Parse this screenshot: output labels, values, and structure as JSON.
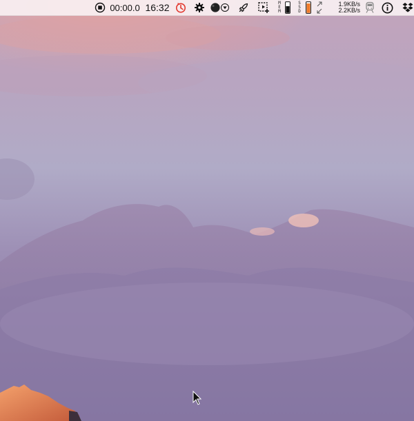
{
  "menubar": {
    "record_timer": "00:00.0",
    "clock": "16:32",
    "mem_label": [
      "M",
      "E",
      "M"
    ],
    "ssd_label": [
      "S",
      "S",
      "D"
    ],
    "net_up": "1.9KB/s",
    "net_down": "2.2KB/s"
  },
  "icons": {
    "record": "record-stop-icon",
    "timer": "timer-icon",
    "settings": "gear-icon",
    "app_dropdown": "app-dropdown-icon",
    "rocket": "rocket-icon",
    "screenshot": "screen-capture-icon",
    "memory": "memory-gauge-icon",
    "ssd": "ssd-gauge-icon",
    "network": "network-arrows-icon",
    "train": "train-icon",
    "info": "info-icon",
    "dropbox": "dropbox-icon"
  },
  "colors": {
    "timer_red": "#e2382e",
    "ssd_orange": "#f07a2a",
    "mem_orange": "#f07a2a"
  }
}
